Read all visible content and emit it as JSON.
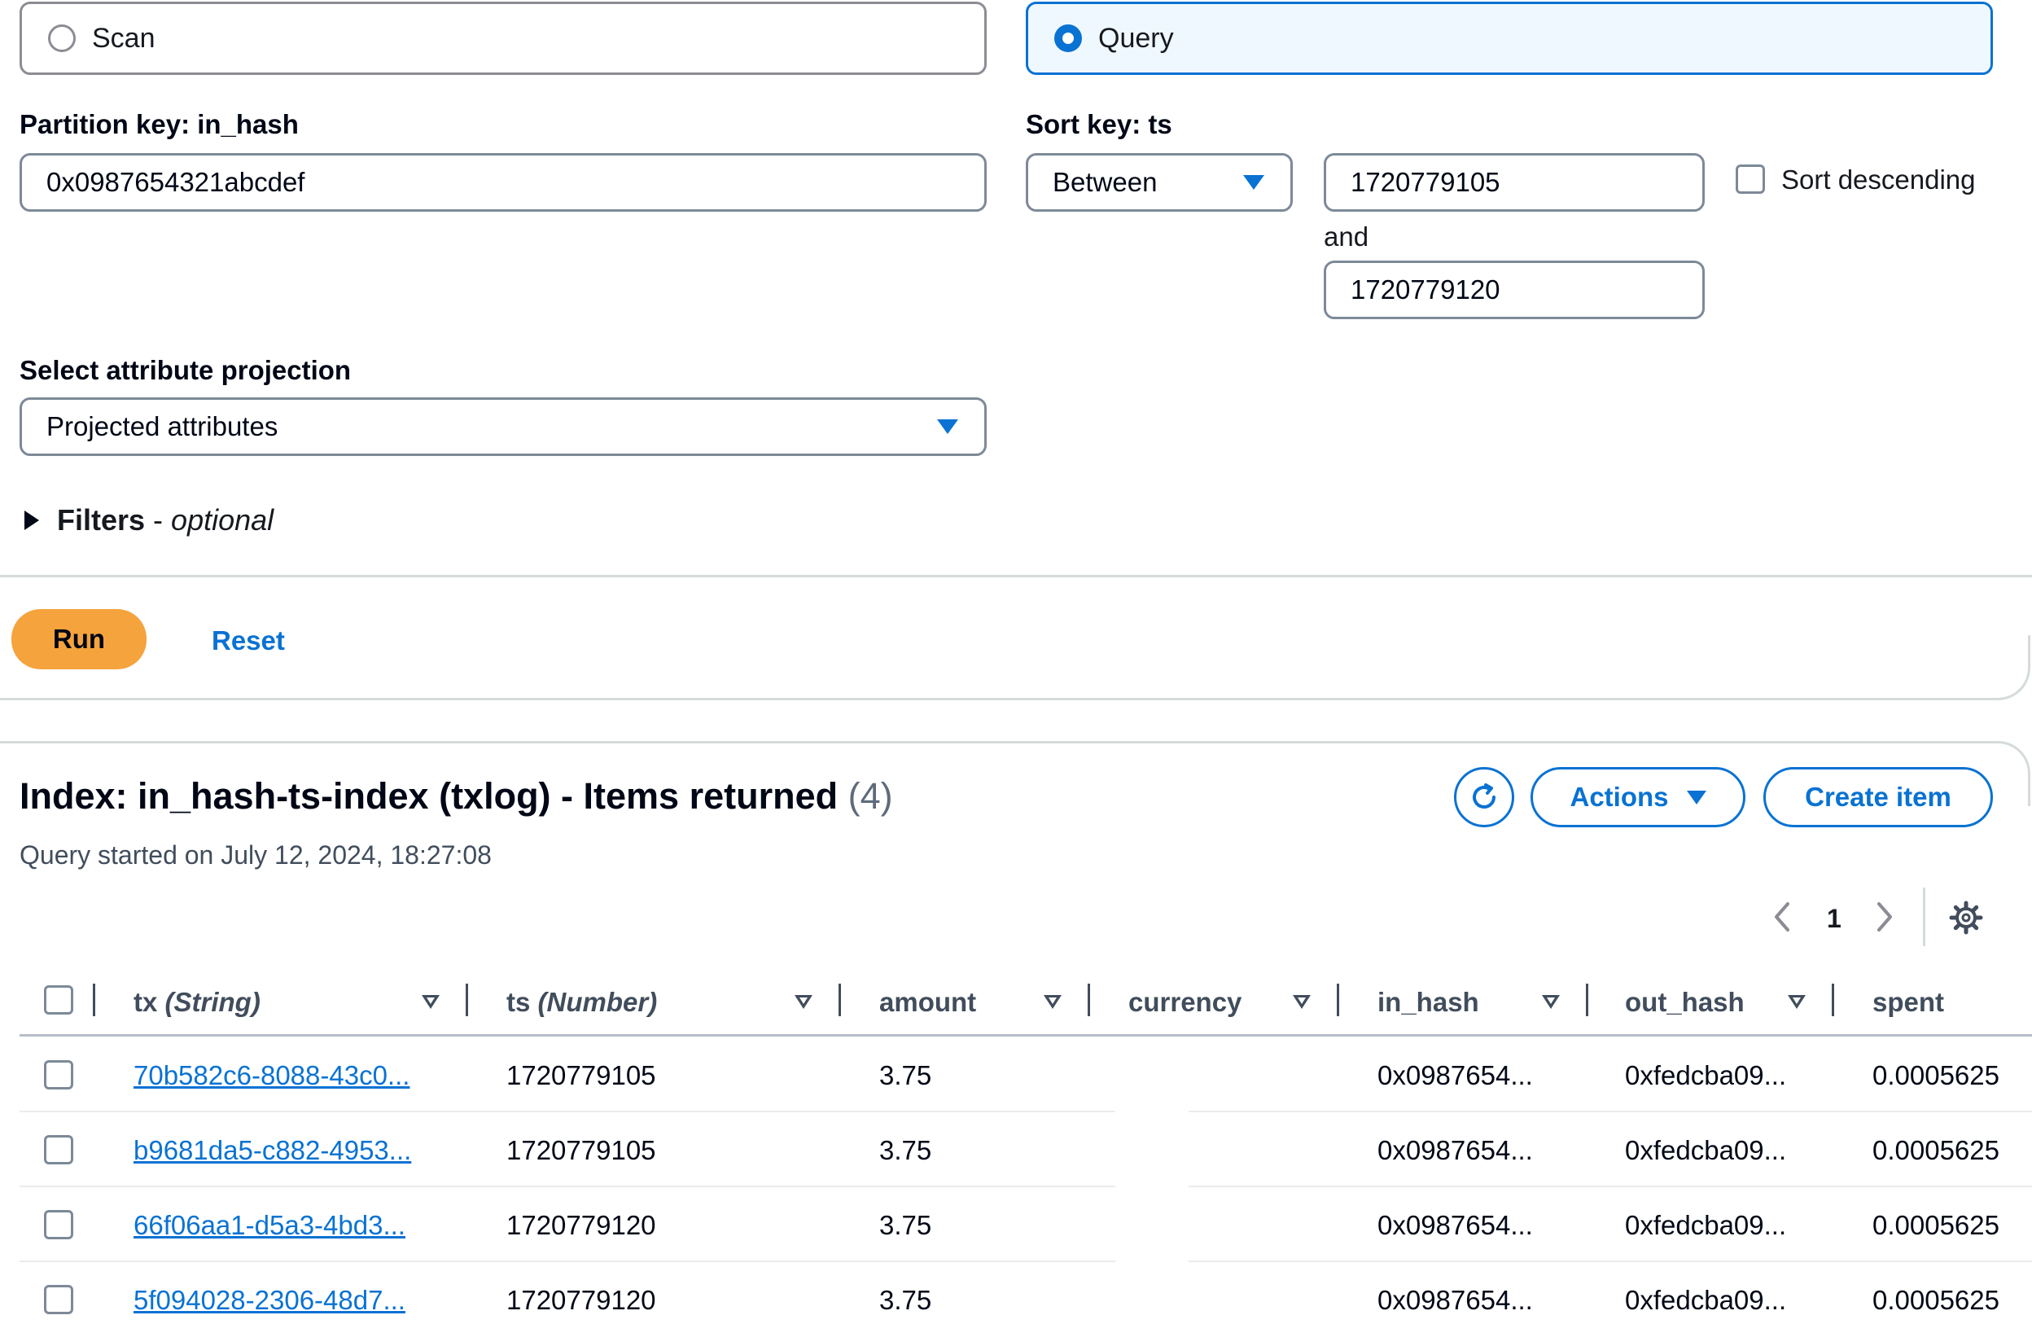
{
  "mode": {
    "scan_label": "Scan",
    "query_label": "Query",
    "selected": "Query"
  },
  "partition": {
    "label": "Partition key: in_hash",
    "value": "0x0987654321abcdef"
  },
  "sort": {
    "label": "Sort key: ts",
    "operator": "Between",
    "value_from": "1720779105",
    "and_label": "and",
    "value_to": "1720779120",
    "descending_label": "Sort descending"
  },
  "projection": {
    "label": "Select attribute projection",
    "value": "Projected attributes"
  },
  "filters": {
    "label": "Filters",
    "separator": " - ",
    "optional": "optional"
  },
  "actions": {
    "run": "Run",
    "reset": "Reset"
  },
  "results": {
    "title": "Index: in_hash-ts-index (txlog) - Items returned",
    "count": "(4)",
    "subtitle": "Query started on July 12, 2024, 18:27:08",
    "actions_label": "Actions",
    "create_label": "Create item",
    "page": "1"
  },
  "table": {
    "columns": [
      {
        "name": "tx",
        "type": "(String)"
      },
      {
        "name": "ts",
        "type": "(Number)"
      },
      {
        "name": "amount",
        "type": ""
      },
      {
        "name": "currency",
        "type": ""
      },
      {
        "name": "in_hash",
        "type": ""
      },
      {
        "name": "out_hash",
        "type": ""
      },
      {
        "name": "spent",
        "type": ""
      }
    ],
    "rows": [
      {
        "tx": "70b582c6-8088-43c0...",
        "ts": "1720779105",
        "amount": "3.75",
        "currency": "",
        "in_hash": "0x0987654...",
        "out_hash": "0xfedcba09...",
        "spent": "0.0005625"
      },
      {
        "tx": "b9681da5-c882-4953...",
        "ts": "1720779105",
        "amount": "3.75",
        "currency": "",
        "in_hash": "0x0987654...",
        "out_hash": "0xfedcba09...",
        "spent": "0.0005625"
      },
      {
        "tx": "66f06aa1-d5a3-4bd3...",
        "ts": "1720779120",
        "amount": "3.75",
        "currency": "",
        "in_hash": "0x0987654...",
        "out_hash": "0xfedcba09...",
        "spent": "0.0005625"
      },
      {
        "tx": "5f094028-2306-48d7...",
        "ts": "1720779120",
        "amount": "3.75",
        "currency": "",
        "in_hash": "0x0987654...",
        "out_hash": "0xfedcba09...",
        "spent": "0.0005625"
      }
    ]
  },
  "colors": {
    "accent": "#0972d3",
    "run_button": "#f5a33c",
    "border": "#7d8998"
  },
  "icons": {
    "refresh": "refresh-icon",
    "settings": "gear-icon",
    "prev": "chevron-left-icon",
    "next": "chevron-right-icon"
  }
}
